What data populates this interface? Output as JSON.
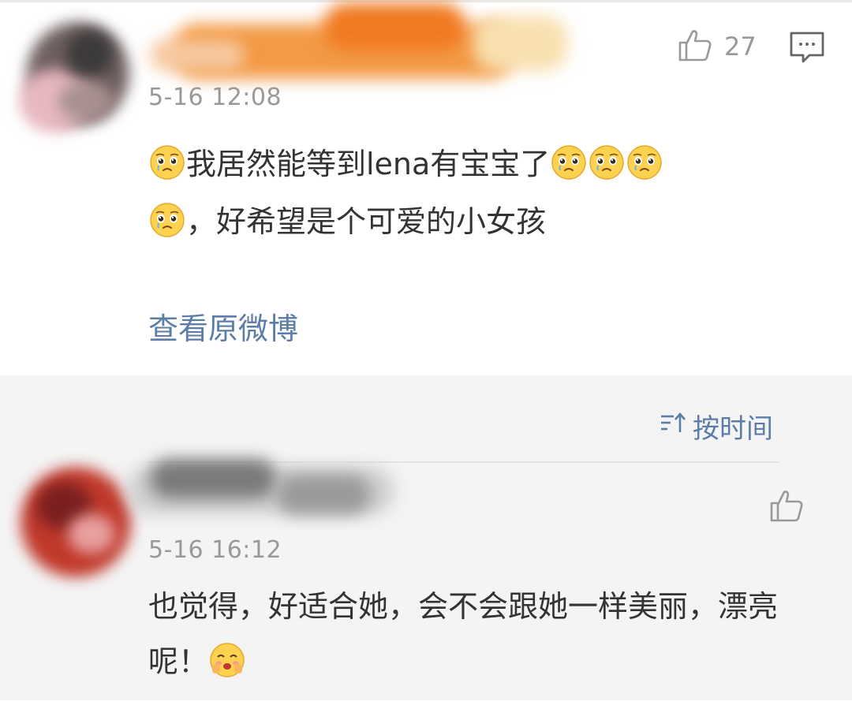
{
  "main_comment": {
    "likes": "27",
    "time": "5-16 12:08",
    "text_part1": "我居然能等到lena有宝宝了",
    "text_part2": "，好希望是个可爱的小女孩",
    "view_original_label": "查看原微博"
  },
  "sort": {
    "label": "按时间"
  },
  "reply": {
    "time": "5-16 16:12",
    "text": "也觉得，好适合她，会不会跟她一样美丽，漂亮呢！"
  },
  "icons": {
    "like": "thumbs-up-icon",
    "comment": "comment-bubble-icon",
    "sort": "sort-icon",
    "emoji_sad": "pleading-face-emoji",
    "emoji_shy": "blushing-face-emoji"
  },
  "colors": {
    "link": "#5b7ea9",
    "time": "#999999",
    "text": "#333333",
    "emoji_yellow": "#fcd34d"
  }
}
